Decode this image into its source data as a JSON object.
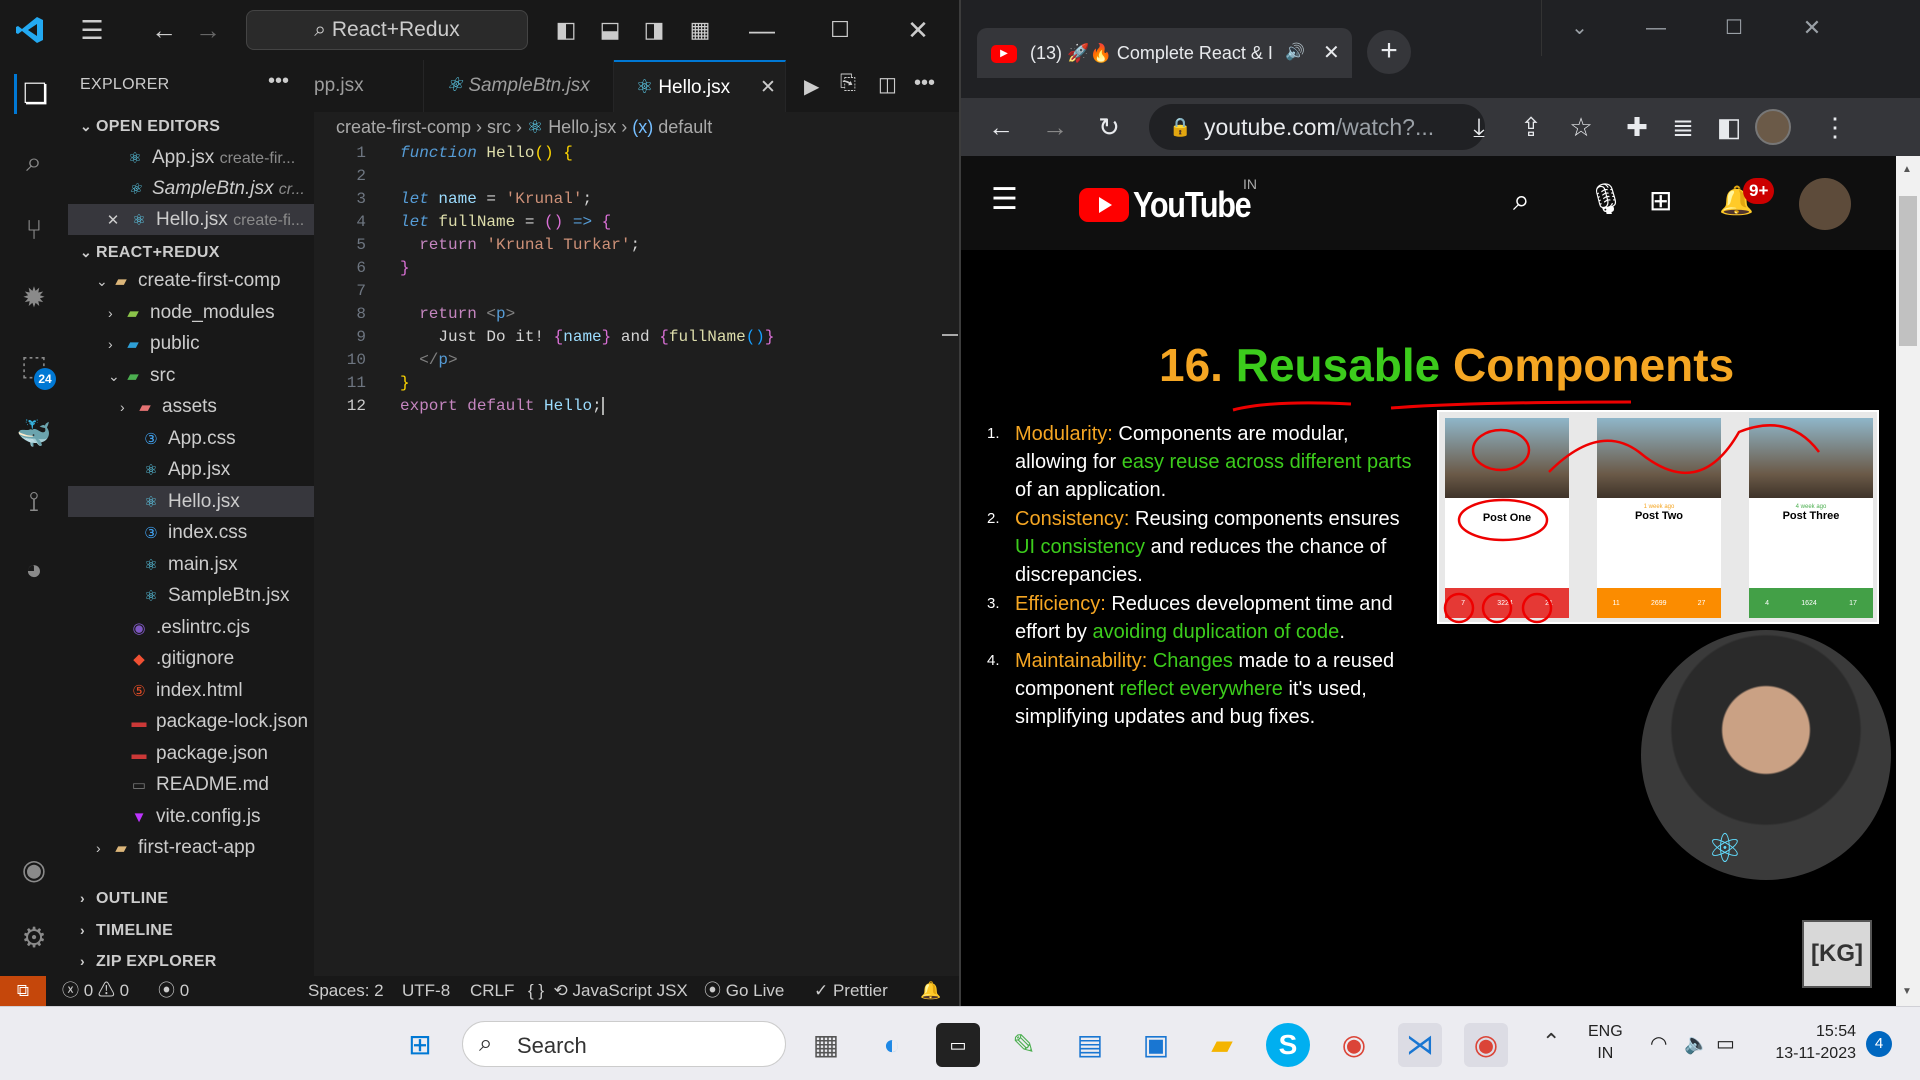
{
  "vscode": {
    "search": "React+Redux",
    "explorer_title": "EXPLORER",
    "open_editors_header": "OPEN EDITORS",
    "open_editors": [
      {
        "name": "App.jsx",
        "dir": "create-fir..."
      },
      {
        "name": "SampleBtn.jsx",
        "dir": "cr..."
      },
      {
        "name": "Hello.jsx",
        "dir": "create-fi..."
      }
    ],
    "workspace_header": "REACT+REDUX",
    "tree": {
      "root": "create-first-comp",
      "node_modules": "node_modules",
      "public": "public",
      "src": "src",
      "assets": "assets",
      "app_css": "App.css",
      "app_jsx": "App.jsx",
      "hello_jsx": "Hello.jsx",
      "index_css": "index.css",
      "main_jsx": "main.jsx",
      "samplebtn_jsx": "SampleBtn.jsx",
      "eslintrc": ".eslintrc.cjs",
      "gitignore": ".gitignore",
      "index_html": "index.html",
      "package_lock": "package-lock.json",
      "package_json": "package.json",
      "readme": "README.md",
      "vite_config": "vite.config.js",
      "first_react_app": "first-react-app"
    },
    "outline": "OUTLINE",
    "timeline": "TIMELINE",
    "zip_explorer": "ZIP EXPLORER",
    "extensions_badge": "24",
    "tabs": [
      "pp.jsx",
      "SampleBtn.jsx",
      "Hello.jsx"
    ],
    "breadcrumb": {
      "folder": "create-first-comp",
      "src": "src",
      "file": "Hello.jsx",
      "symbol": "default",
      "symbol_prefix": "(x)"
    },
    "line_numbers": [
      "1",
      "2",
      "3",
      "4",
      "5",
      "6",
      "7",
      "8",
      "9",
      "10",
      "11",
      "12"
    ],
    "status": {
      "errors": "0",
      "warnings": "0",
      "ports": "0",
      "spaces": "Spaces: 2",
      "encoding": "UTF-8",
      "eol": "CRLF",
      "language": "JavaScript JSX",
      "golive": "Go Live",
      "prettier": "Prettier"
    }
  },
  "chrome": {
    "tab_title": "(13) 🚀🔥 Complete React & I",
    "url_host": "youtube.com",
    "url_path": "/watch?...",
    "youtube_logo": "YouTube",
    "youtube_region": "IN",
    "notification_count": "9+",
    "slide": {
      "title_num": "16.",
      "title_w1": "Reusable",
      "title_w2": "Components",
      "items": [
        {
          "n": "1.",
          "label": "Modularity:",
          "t1": " Components are modular, allowing for ",
          "g1": "easy reuse across different parts",
          "t2": " of an application."
        },
        {
          "n": "2.",
          "label": "Consistency:",
          "t1": " Reusing components ensures ",
          "g1": "UI consistency",
          "t2": " and reduces the chance of discrepancies."
        },
        {
          "n": "3.",
          "label": "Efficiency:",
          "t1": " Reduces development time and effort by ",
          "g1": "avoiding duplication of code",
          "t2": "."
        },
        {
          "n": "4.",
          "label": "Maintainability:",
          "t1": " ",
          "g1": "Changes",
          "t1b": " made to a reused component ",
          "g2": "reflect everywhere",
          "t2": " it's used, simplifying updates and bug fixes."
        }
      ],
      "cards": [
        "Post One",
        "Post Two",
        "Post Three"
      ],
      "card_dates": [
        "1 week ago",
        "4 week ago"
      ],
      "card_stats": [
        [
          "7",
          "3224",
          "21"
        ],
        [
          "11",
          "2699",
          "27"
        ],
        [
          "4",
          "1624",
          "17"
        ]
      ],
      "card_stat_labels": [
        "Reads",
        "Views",
        "Comments"
      ],
      "watermark": "[KG]"
    }
  },
  "taskbar": {
    "search": "Search",
    "lang1": "ENG",
    "lang2": "IN",
    "time": "15:54",
    "date": "13-11-2023",
    "notif": "4"
  }
}
